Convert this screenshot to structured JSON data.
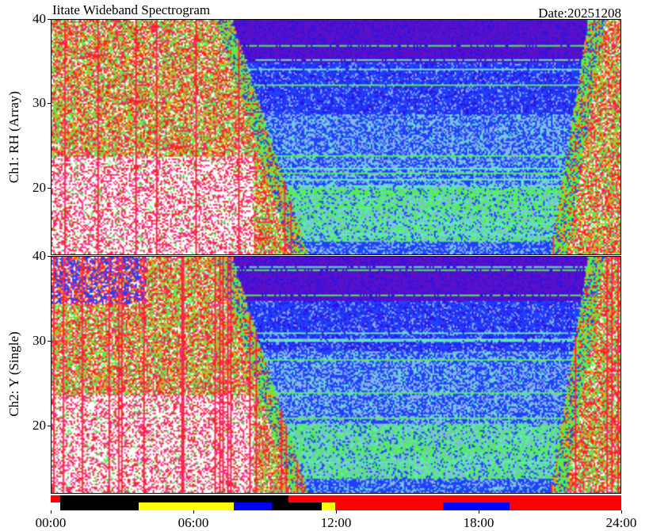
{
  "header": {
    "title": "Iitate Wideband Spectrogram",
    "date": "Date:20251208"
  },
  "chart_data": {
    "type": "heatmap",
    "title": "Iitate Wideband Spectrogram",
    "x_ticks": [
      "00:00",
      "06:00",
      "12:00",
      "18:00",
      "24:00"
    ],
    "x_range_hours": [
      0,
      24
    ],
    "y_range": [
      12,
      40
    ],
    "y_ticks": [
      20,
      30,
      40
    ],
    "panels": [
      {
        "name": "Ch1: RH (Array)",
        "ylabel": "Ch1: RH (Array)"
      },
      {
        "name": "Ch2: Y (Single)",
        "ylabel": "Ch2: Y (Single)"
      }
    ],
    "colors": {
      "white": "#ffffff",
      "magenta": "#ff2d8a",
      "red": "#ff2020",
      "orange": "#ffa010",
      "green": "#50f050",
      "cyan": "#60e8c0",
      "lightblue": "#8ab0f0",
      "blue": "#2040ff",
      "darkblue": "#3010e0",
      "purple": "#5a10c8"
    },
    "status_bars": [
      {
        "row": 1,
        "segments": [
          {
            "start_hour": 0.0,
            "end_hour": 0.4,
            "color": "#ff0000"
          },
          {
            "start_hour": 0.4,
            "end_hour": 10.0,
            "color": "#000000"
          },
          {
            "start_hour": 10.0,
            "end_hour": 24.0,
            "color": "#ff0000"
          }
        ]
      },
      {
        "row": 2,
        "segments": [
          {
            "start_hour": 0.4,
            "end_hour": 3.7,
            "color": "#000000"
          },
          {
            "start_hour": 3.7,
            "end_hour": 7.7,
            "color": "#ffff00"
          },
          {
            "start_hour": 7.7,
            "end_hour": 9.3,
            "color": "#0000ff"
          },
          {
            "start_hour": 9.3,
            "end_hour": 11.4,
            "color": "#000000"
          },
          {
            "start_hour": 11.4,
            "end_hour": 11.95,
            "color": "#ffff00"
          },
          {
            "start_hour": 11.95,
            "end_hour": 16.5,
            "color": "#ff0000"
          },
          {
            "start_hour": 16.5,
            "end_hour": 19.3,
            "color": "#0000ff"
          },
          {
            "start_hour": 19.3,
            "end_hour": 24.0,
            "color": "#ff0000"
          }
        ]
      }
    ]
  }
}
